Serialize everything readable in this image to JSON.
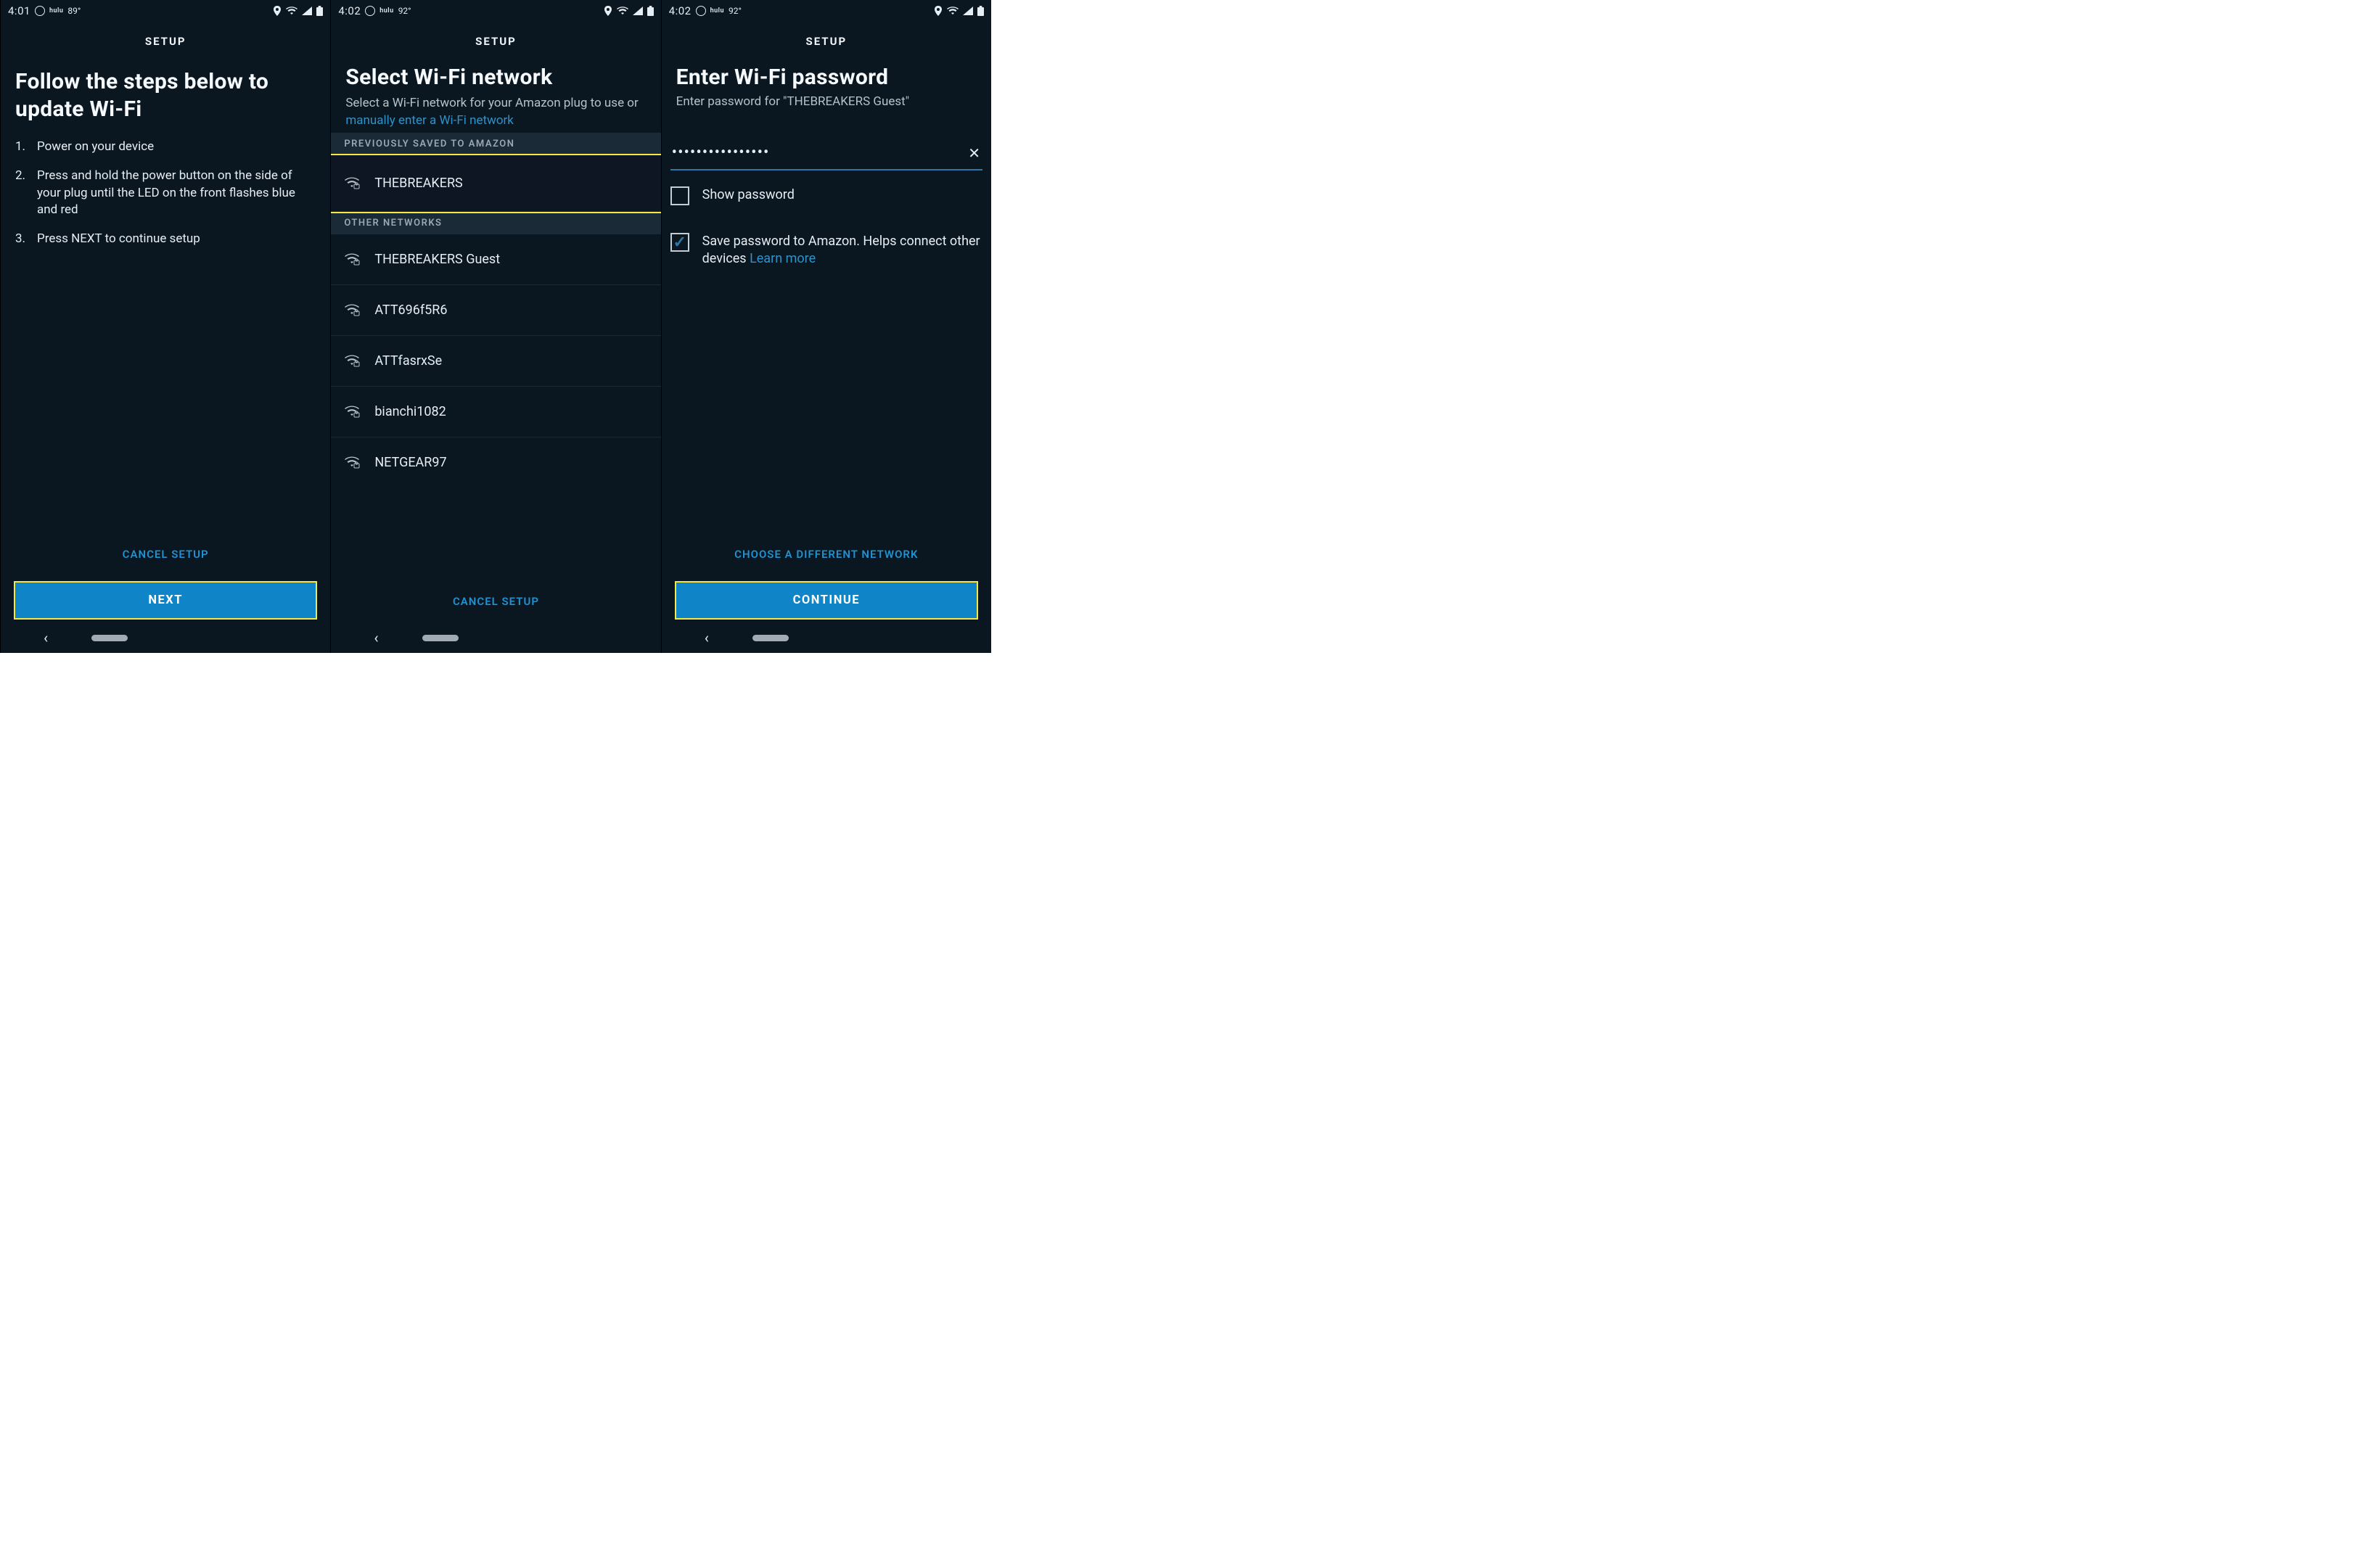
{
  "common": {
    "title": "SETUP",
    "cancel": "CANCEL SETUP"
  },
  "status": {
    "s1": {
      "time": "4:01",
      "hulu": "hulu",
      "temp": "89°"
    },
    "s2": {
      "time": "4:02",
      "hulu": "hulu",
      "temp": "92°"
    },
    "s3": {
      "time": "4:02",
      "hulu": "hulu",
      "temp": "92°"
    }
  },
  "screen1": {
    "heading": "Follow the steps below to update Wi-Fi",
    "steps": {
      "n1": "1.",
      "t1": "Power on your device",
      "n2": "2.",
      "t2": "Press and hold the power button on the side of your plug until the LED on the front flashes blue and red",
      "n3": "3.",
      "t3": "Press NEXT to continue setup"
    },
    "next": "NEXT"
  },
  "screen2": {
    "heading": "Select Wi-Fi network",
    "subtitle_a": "Select a Wi-Fi network for your Amazon plug to use or ",
    "subtitle_link": "manually enter a Wi-Fi network",
    "section_saved": "PREVIOUSLY SAVED TO AMAZON",
    "section_other": "OTHER NETWORKS",
    "saved0": "THEBREAKERS",
    "other0": "THEBREAKERS Guest",
    "other1": "ATT696f5R6",
    "other2": "ATTfasrxSe",
    "other3": "bianchi1082",
    "other4": "NETGEAR97"
  },
  "screen3": {
    "heading": "Enter Wi-Fi password",
    "subtitle": "Enter password for \"THEBREAKERS Guest\"",
    "password_masked": "••••••••••••••••",
    "show_pw": "Show password",
    "save_pw": "Save password to Amazon. Helps connect other devices  ",
    "learn_more": "Learn more",
    "choose_diff": "CHOOSE A DIFFERENT NETWORK",
    "continue": "CONTINUE"
  }
}
